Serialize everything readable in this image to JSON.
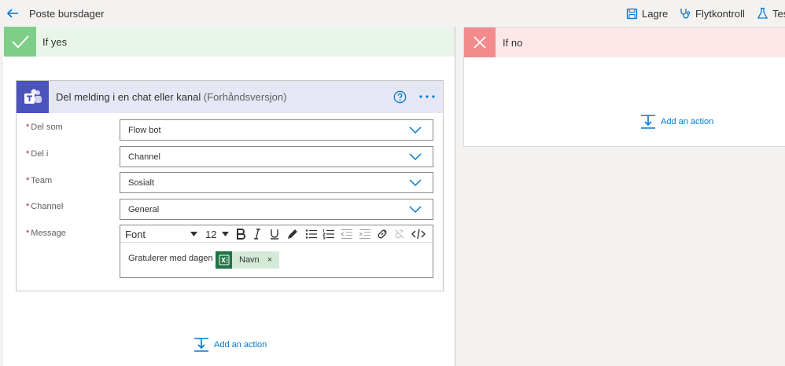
{
  "header": {
    "flow_title": "Poste bursdager",
    "commands": [
      {
        "label": "Lagre",
        "icon": "save-icon"
      },
      {
        "label": "Flytkontroll",
        "icon": "stethoscope-icon"
      },
      {
        "label": "Tes",
        "icon": "beaker-icon"
      }
    ]
  },
  "yes_branch": {
    "label": "If yes",
    "icon": "checkmark-icon",
    "accent": "#7fce87",
    "header_bg": "#eaf5ea",
    "action_card": {
      "title": "Del melding i en chat eller kanal",
      "title_suffix": "(Forhåndsversjon)",
      "icon": "teams-icon",
      "fields": [
        {
          "label": "Del som",
          "required": "*",
          "value": "Flow bot"
        },
        {
          "label": "Del i",
          "required": "*",
          "value": "Channel"
        },
        {
          "label": "Team",
          "required": "*",
          "value": "Sosialt"
        },
        {
          "label": "Channel",
          "required": "*",
          "value": "General"
        }
      ],
      "message": {
        "label": "Message",
        "required": "*",
        "toolbar": {
          "font": "Font",
          "size": "12"
        },
        "text": "Gratulerer med dagen",
        "token": {
          "label": "Navn",
          "icon": "excel-icon",
          "remove": "×"
        }
      }
    },
    "add_action": "Add an action"
  },
  "no_branch": {
    "label": "If no",
    "icon": "close-icon",
    "accent": "#f28c8c",
    "header_bg": "#fde7e9",
    "add_action": "Add an action"
  }
}
